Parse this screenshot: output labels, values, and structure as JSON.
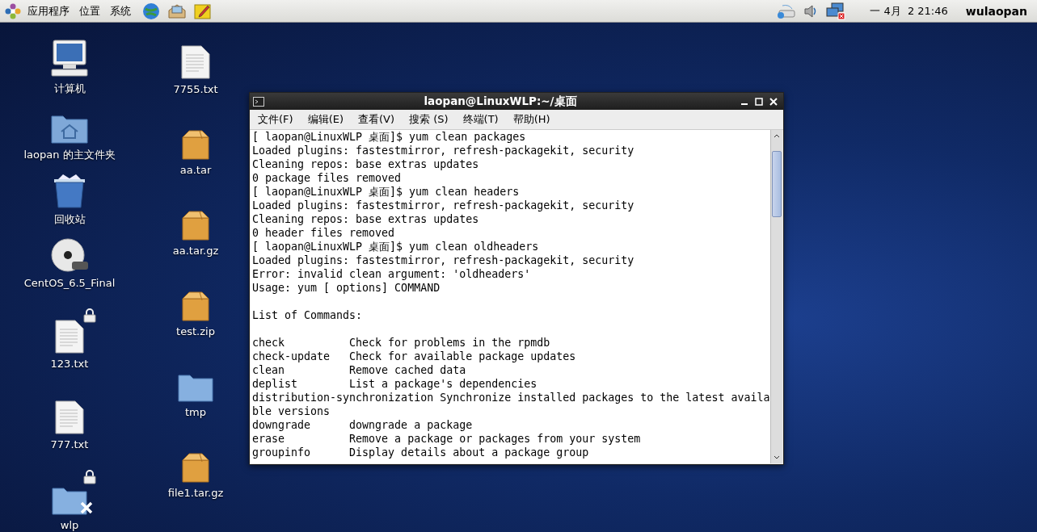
{
  "top_panel": {
    "menus": [
      "应用程序",
      "位置",
      "系统"
    ],
    "clock": "一 4月  2 21:46",
    "user": "wulaopan"
  },
  "desktop_icons_left": [
    {
      "label": "计算机",
      "kind": "computer",
      "locked": false,
      "crossed": false
    },
    {
      "label": "laopan 的主文件夹",
      "kind": "home",
      "locked": false,
      "crossed": false
    },
    {
      "label": "回收站",
      "kind": "trash",
      "locked": false,
      "crossed": false
    },
    {
      "label": "CentOS_6.5_Final",
      "kind": "dvd",
      "locked": false,
      "crossed": false
    },
    {
      "label": "123.txt",
      "kind": "text",
      "locked": true,
      "crossed": false
    },
    {
      "label": "777.txt",
      "kind": "text",
      "locked": false,
      "crossed": false
    },
    {
      "label": "wlp",
      "kind": "folder",
      "locked": true,
      "crossed": true
    }
  ],
  "desktop_icons_right": [
    {
      "label": "7755.txt",
      "kind": "text",
      "locked": false,
      "crossed": false
    },
    {
      "label": "aa.tar",
      "kind": "archive",
      "locked": false,
      "crossed": false
    },
    {
      "label": "aa.tar.gz",
      "kind": "archive",
      "locked": false,
      "crossed": false
    },
    {
      "label": "test.zip",
      "kind": "archive",
      "locked": false,
      "crossed": false
    },
    {
      "label": "tmp",
      "kind": "folder",
      "locked": false,
      "crossed": false
    },
    {
      "label": "file1.tar.gz",
      "kind": "archive",
      "locked": false,
      "crossed": false
    }
  ],
  "terminal": {
    "title": "laopan@LinuxWLP:~/桌面",
    "menu": [
      "文件(F)",
      "编辑(E)",
      "查看(V)",
      "搜索 (S)",
      "终端(T)",
      "帮助(H)"
    ],
    "lines": [
      {
        "kind": "text",
        "text": "[ laopan@LinuxWLP 桌面]$ yum clean packages"
      },
      {
        "kind": "text",
        "text": "Loaded plugins: fastestmirror, refresh-packagekit, security"
      },
      {
        "kind": "text",
        "text": "Cleaning repos: base extras updates"
      },
      {
        "kind": "text",
        "text": "0 package files removed"
      },
      {
        "kind": "text",
        "text": "[ laopan@LinuxWLP 桌面]$ yum clean headers"
      },
      {
        "kind": "text",
        "text": "Loaded plugins: fastestmirror, refresh-packagekit, security"
      },
      {
        "kind": "text",
        "text": "Cleaning repos: base extras updates"
      },
      {
        "kind": "text",
        "text": "0 header files removed"
      },
      {
        "kind": "text",
        "text": "[ laopan@LinuxWLP 桌面]$ yum clean oldheaders"
      },
      {
        "kind": "text",
        "text": "Loaded plugins: fastestmirror, refresh-packagekit, security"
      },
      {
        "kind": "text",
        "text": "Error: invalid clean argument: 'oldheaders'"
      },
      {
        "kind": "text",
        "text": "Usage: yum [ options] COMMAND"
      },
      {
        "kind": "blank"
      },
      {
        "kind": "text",
        "text": "List of Commands:"
      },
      {
        "kind": "blank"
      },
      {
        "kind": "text",
        "text": "check          Check for problems in the rpmdb"
      },
      {
        "kind": "text",
        "text": "check-update   Check for available package updates"
      },
      {
        "kind": "text",
        "text": "clean          Remove cached data"
      },
      {
        "kind": "text",
        "text": "deplist        List a package's dependencies"
      },
      {
        "kind": "text",
        "text": "distribution-synchronization Synchronize installed packages to the latest availa"
      },
      {
        "kind": "text",
        "text": "ble versions"
      },
      {
        "kind": "text",
        "text": "downgrade      downgrade a package"
      },
      {
        "kind": "text",
        "text": "erase          Remove a package or packages from your system"
      },
      {
        "kind": "text",
        "text": "groupinfo      Display details about a package group"
      }
    ]
  }
}
